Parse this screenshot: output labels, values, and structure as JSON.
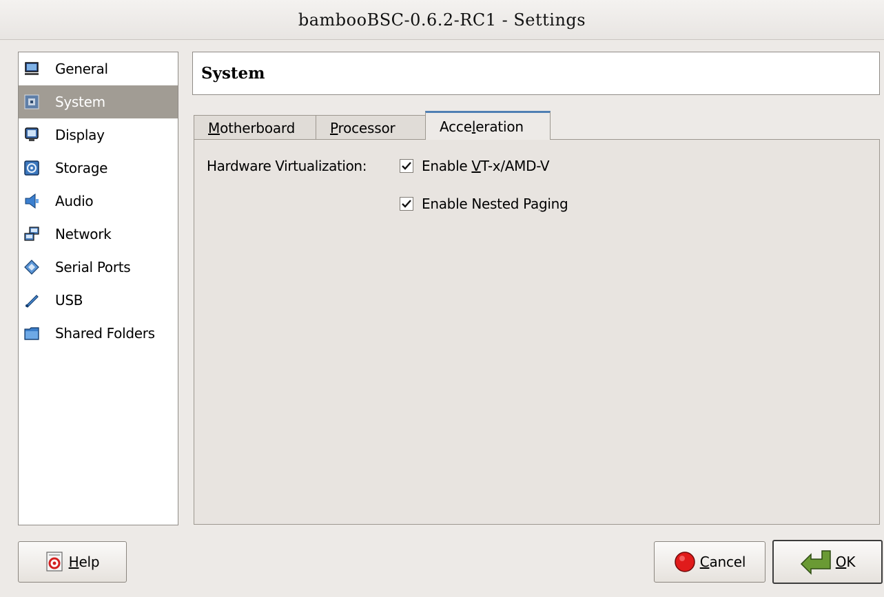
{
  "window": {
    "title": "bambooBSC-0.6.2-RC1 - Settings"
  },
  "sidebar": {
    "items": [
      {
        "label": "General",
        "icon": "monitor-icon",
        "selected": false
      },
      {
        "label": "System",
        "icon": "chip-icon",
        "selected": true
      },
      {
        "label": "Display",
        "icon": "display-icon",
        "selected": false
      },
      {
        "label": "Storage",
        "icon": "disk-icon",
        "selected": false
      },
      {
        "label": "Audio",
        "icon": "speaker-icon",
        "selected": false
      },
      {
        "label": "Network",
        "icon": "network-icon",
        "selected": false
      },
      {
        "label": "Serial Ports",
        "icon": "serial-port-icon",
        "selected": false
      },
      {
        "label": "USB",
        "icon": "usb-icon",
        "selected": false
      },
      {
        "label": "Shared Folders",
        "icon": "folder-icon",
        "selected": false
      }
    ]
  },
  "page": {
    "title": "System"
  },
  "tabs": {
    "motherboard": {
      "prefix": "",
      "accel": "M",
      "rest": "otherboard"
    },
    "processor": {
      "prefix": "",
      "accel": "P",
      "rest": "rocessor"
    },
    "acceleration": {
      "prefix": "Acce",
      "accel": "l",
      "rest": "eration",
      "active": true
    }
  },
  "acceleration": {
    "hw_virt_label": "Hardware Virtualization:",
    "vtx": {
      "prefix": "Enable ",
      "accel": "V",
      "rest": "T-x/AMD-V",
      "checked": true
    },
    "nested": {
      "prefix": "Enable Nested Pa",
      "accel": "g",
      "rest": "ing",
      "checked": true
    }
  },
  "buttons": {
    "help": {
      "prefix": "",
      "accel": "H",
      "rest": "elp"
    },
    "cancel": {
      "prefix": "",
      "accel": "C",
      "rest": "ancel"
    },
    "ok": {
      "prefix": "",
      "accel": "O",
      "rest": "K"
    }
  },
  "colors": {
    "selected_bg": "#a19c94",
    "active_tab_accent": "#4f7fb3",
    "cancel_icon": "#e01b1b",
    "ok_icon": "#5d8a2c"
  }
}
